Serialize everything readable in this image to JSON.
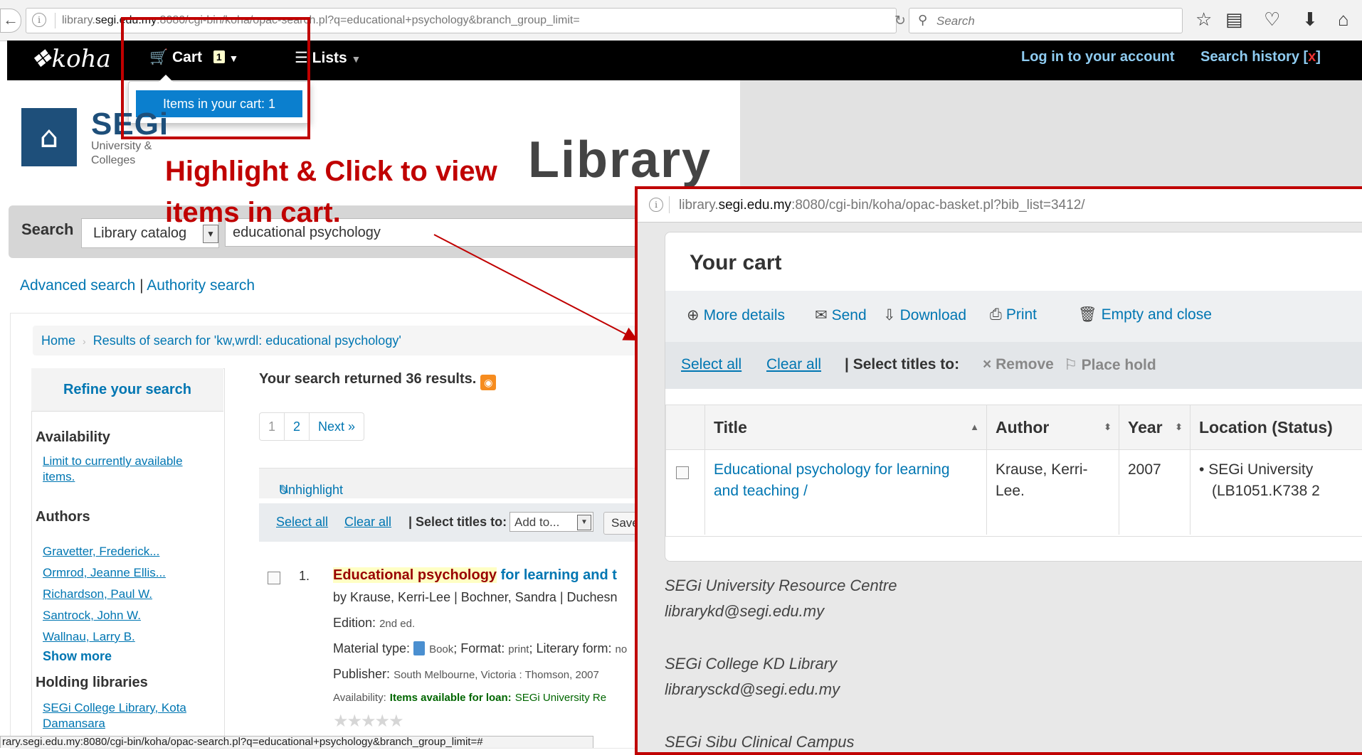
{
  "browser": {
    "url_prefix": "library.",
    "url_domain": "segi.edu.my",
    "url_rest": ":8080/cgi-bin/koha/opac-search.pl?q=educational+psychology&branch_group_limit=",
    "search_placeholder": "Search",
    "status_url": "rary.segi.edu.my:8080/cgi-bin/koha/opac-search.pl?q=educational+psychology&branch_group_limit=#"
  },
  "navbar": {
    "logo": "koha",
    "cart_label": "Cart",
    "cart_count": "1",
    "lists_label": "Lists",
    "login_label": "Log in to your account",
    "history_label": "Search history [",
    "history_clear": "x",
    "history_close": "]"
  },
  "cart_menu": {
    "item_label": "Items in your cart: 1"
  },
  "header": {
    "org_name": "SEGi",
    "org_sub": "University & Colleges",
    "library_word": "Library"
  },
  "annotation": {
    "text": "Highlight & Click to view items in cart."
  },
  "search": {
    "label": "Search",
    "catalog": "Library catalog",
    "query": "educational psychology",
    "advanced": "Advanced search",
    "divider": "|",
    "authority": "Authority search"
  },
  "breadcrumb": {
    "home": "Home",
    "current": "Results of search for 'kw,wrdl: educational psychology'"
  },
  "refine": {
    "title": "Refine your search",
    "availability_heading": "Availability",
    "availability_link": "Limit to currently available items.",
    "authors_heading": "Authors",
    "authors": [
      "Gravetter, Frederick...",
      "Ormrod, Jeanne Ellis...",
      "Richardson, Paul W.",
      "Santrock, John W.",
      "Wallnau, Larry B."
    ],
    "show_more": "Show more",
    "holding_heading": "Holding libraries",
    "holding_link": "SEGi College Library, Kota Damansara"
  },
  "results": {
    "count_text": "Your search returned 36 results.",
    "pages": [
      "1",
      "2",
      "Next »"
    ],
    "unhighlight": "Unhighlight",
    "select_all": "Select all",
    "clear_all": "Clear all",
    "select_titles": "| Select titles to:",
    "add_to": "Add to...",
    "save": "Save",
    "item": {
      "number": "1.",
      "title_hl": "Educational psychology",
      "title_rest": " for learning and t",
      "by": "by Krause, Kerri-Lee | Bochner, Sandra | Duchesn",
      "edition_label": "Edition:",
      "edition": "2nd ed.",
      "material_label": "Material type:",
      "material": "Book",
      "format_label": "; Format:",
      "format": "print",
      "literary_label": "; Literary form:",
      "literary": "no",
      "publisher_label": "Publisher:",
      "publisher": "South Melbourne, Victoria : Thomson, 2007",
      "availability_label": "Availability:",
      "availability": "Items available for loan:",
      "availability_where": "SEGi University Re"
    }
  },
  "popup": {
    "url_prefix": "library.",
    "url_domain": "segi.edu.my",
    "url_rest": ":8080/cgi-bin/koha/opac-basket.pl?bib_list=3412/",
    "title": "Your cart",
    "tools": {
      "more": "More details",
      "send": "Send",
      "download": "Download",
      "print": "Print",
      "empty": "Empty and close"
    },
    "select_all": "Select all",
    "clear_all": "Clear all",
    "select_titles": "| Select titles to:",
    "remove": "Remove",
    "place_hold": "Place hold",
    "columns": {
      "title": "Title",
      "author": "Author",
      "year": "Year",
      "location": "Location (Status)"
    },
    "row": {
      "title": "Educational psychology for learning and teaching /",
      "author": "Krause, Kerri-Lee.",
      "year": "2007",
      "location": "SEGi University",
      "callno": "(LB1051.K738 2"
    },
    "footer": [
      {
        "name": "SEGi University Resource Centre",
        "email": "librarykd@segi.edu.my"
      },
      {
        "name": "SEGi College KD Library",
        "email": "librarysckd@segi.edu.my"
      },
      {
        "name": "SEGi Sibu Clinical Campus",
        "email": ""
      }
    ]
  },
  "colors": {
    "annotation": "#c00000",
    "navbar": "#000000",
    "link": "#0076b2",
    "cart_menu": "#0b7fce"
  }
}
